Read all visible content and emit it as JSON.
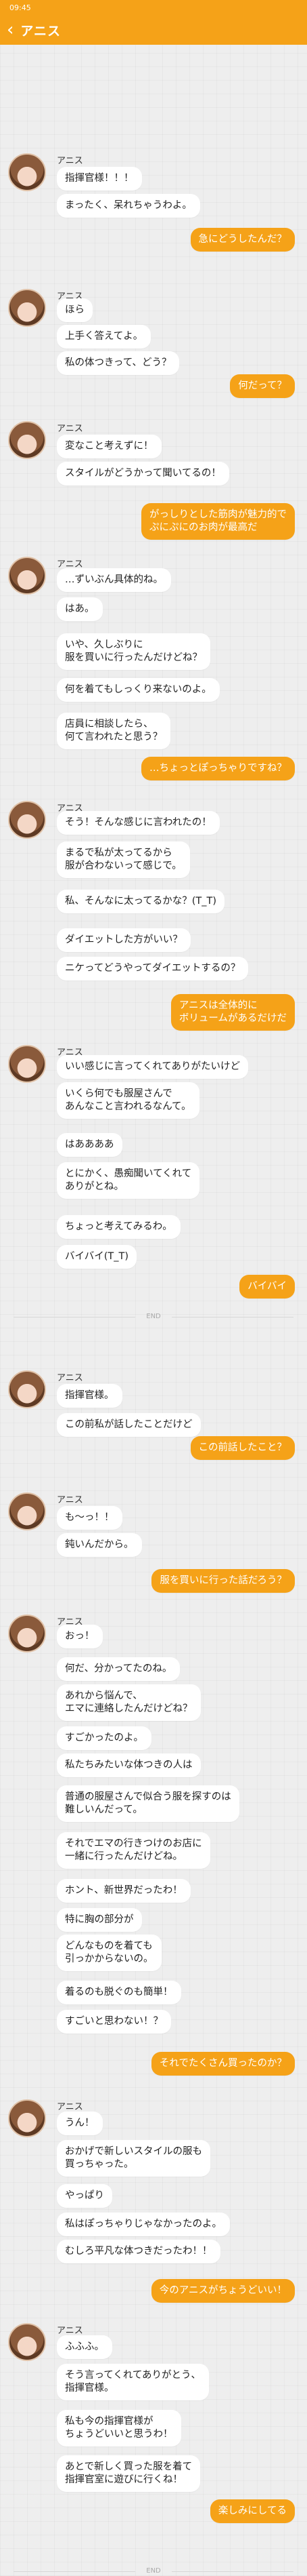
{
  "status": {
    "time": "09:45"
  },
  "header": {
    "title": "アニス"
  },
  "speaker_name": "アニス",
  "end_label": "END",
  "messages": [
    {
      "who": "anis",
      "text": "指揮官様！！！"
    },
    {
      "who": "anis",
      "text": "まったく、呆れちゃうわよ。"
    },
    {
      "who": "me",
      "text": "急にどうしたんだ？"
    },
    {
      "who": "anis",
      "text": "ほら"
    },
    {
      "who": "anis",
      "text": "上手く答えてよ。"
    },
    {
      "who": "anis",
      "text": "私の体つきって、どう？"
    },
    {
      "who": "me",
      "text": "何だって？"
    },
    {
      "who": "anis",
      "text": "変なこと考えずに！"
    },
    {
      "who": "anis",
      "text": "スタイルがどうかって聞いてるの！"
    },
    {
      "who": "me",
      "text": "がっしりとした筋肉が魅力的で\nぷにぷにのお肉が最高だ"
    },
    {
      "who": "anis",
      "text": "…ずいぶん具体的ね。"
    },
    {
      "who": "anis",
      "text": "はあ。"
    },
    {
      "who": "anis",
      "text": "いや、久しぶりに\n服を買いに行ったんだけどね？"
    },
    {
      "who": "anis",
      "text": "何を着てもしっくり来ないのよ。"
    },
    {
      "who": "anis",
      "text": "店員に相談したら、\n何て言われたと思う？"
    },
    {
      "who": "me",
      "text": "…ちょっとぽっちゃりですね？"
    },
    {
      "who": "anis",
      "text": "そう！そんな感じに言われたの！"
    },
    {
      "who": "anis",
      "text": "まるで私が太ってるから\n服が合わないって感じで。"
    },
    {
      "who": "anis",
      "text": "私、そんなに太ってるかな？(T_T)"
    },
    {
      "who": "anis",
      "text": "ダイエットした方がいい？"
    },
    {
      "who": "anis",
      "text": "ニケってどうやってダイエットするの？"
    },
    {
      "who": "me",
      "text": "アニスは全体的に\nボリュームがあるだけだ"
    },
    {
      "who": "anis",
      "text": "いい感じに言ってくれてありがたいけど"
    },
    {
      "who": "anis",
      "text": "いくら何でも服屋さんで\nあんなこと言われるなんて。"
    },
    {
      "who": "anis",
      "text": "はああああ"
    },
    {
      "who": "anis",
      "text": "とにかく、愚痴聞いてくれて\nありがとね。"
    },
    {
      "who": "anis",
      "text": "ちょっと考えてみるわ。"
    },
    {
      "who": "anis",
      "text": "バイバイ(T_T)"
    },
    {
      "who": "me",
      "text": "バイバイ"
    },
    {
      "who": "anis",
      "text": "指揮官様。"
    },
    {
      "who": "anis",
      "text": "この前私が話したことだけど"
    },
    {
      "who": "me",
      "text": "この前話したこと？"
    },
    {
      "who": "anis",
      "text": "も〜っ！！"
    },
    {
      "who": "anis",
      "text": "鈍いんだから。"
    },
    {
      "who": "me",
      "text": "服を買いに行った話だろう？"
    },
    {
      "who": "anis",
      "text": "おっ！"
    },
    {
      "who": "anis",
      "text": "何だ、分かってたのね。"
    },
    {
      "who": "anis",
      "text": "あれから悩んで、\nエマに連絡したんだけどね？"
    },
    {
      "who": "anis",
      "text": "すごかったのよ。"
    },
    {
      "who": "anis",
      "text": "私たちみたいな体つきの人は"
    },
    {
      "who": "anis",
      "text": "普通の服屋さんで似合う服を探すのは\n難しいんだって。"
    },
    {
      "who": "anis",
      "text": "それでエマの行きつけのお店に\n一緒に行ったんだけどね。"
    },
    {
      "who": "anis",
      "text": "ホント、新世界だったわ！"
    },
    {
      "who": "anis",
      "text": "特に胸の部分が"
    },
    {
      "who": "anis",
      "text": "どんなものを着ても\n引っかからないの。"
    },
    {
      "who": "anis",
      "text": "着るのも脱ぐのも簡単！"
    },
    {
      "who": "anis",
      "text": "すごいと思わない！？"
    },
    {
      "who": "me",
      "text": "それでたくさん買ったのか？"
    },
    {
      "who": "anis",
      "text": "うん！"
    },
    {
      "who": "anis",
      "text": "おかげで新しいスタイルの服も\n買っちゃった。"
    },
    {
      "who": "anis",
      "text": "やっぱり"
    },
    {
      "who": "anis",
      "text": "私はぽっちゃりじゃなかったのよ。"
    },
    {
      "who": "anis",
      "text": "むしろ平凡な体つきだったわ！！"
    },
    {
      "who": "me",
      "text": "今のアニスがちょうどいい！"
    },
    {
      "who": "anis",
      "text": "ふふふ。"
    },
    {
      "who": "anis",
      "text": "そう言ってくれてありがとう、\n指揮官様。"
    },
    {
      "who": "anis",
      "text": "私も今の指揮官様が\nちょうどいいと思うわ！"
    },
    {
      "who": "anis",
      "text": "あとで新しく買った服を着て\n指揮官室に遊びに行くね！"
    },
    {
      "who": "me",
      "text": "楽しみにしてる"
    }
  ]
}
